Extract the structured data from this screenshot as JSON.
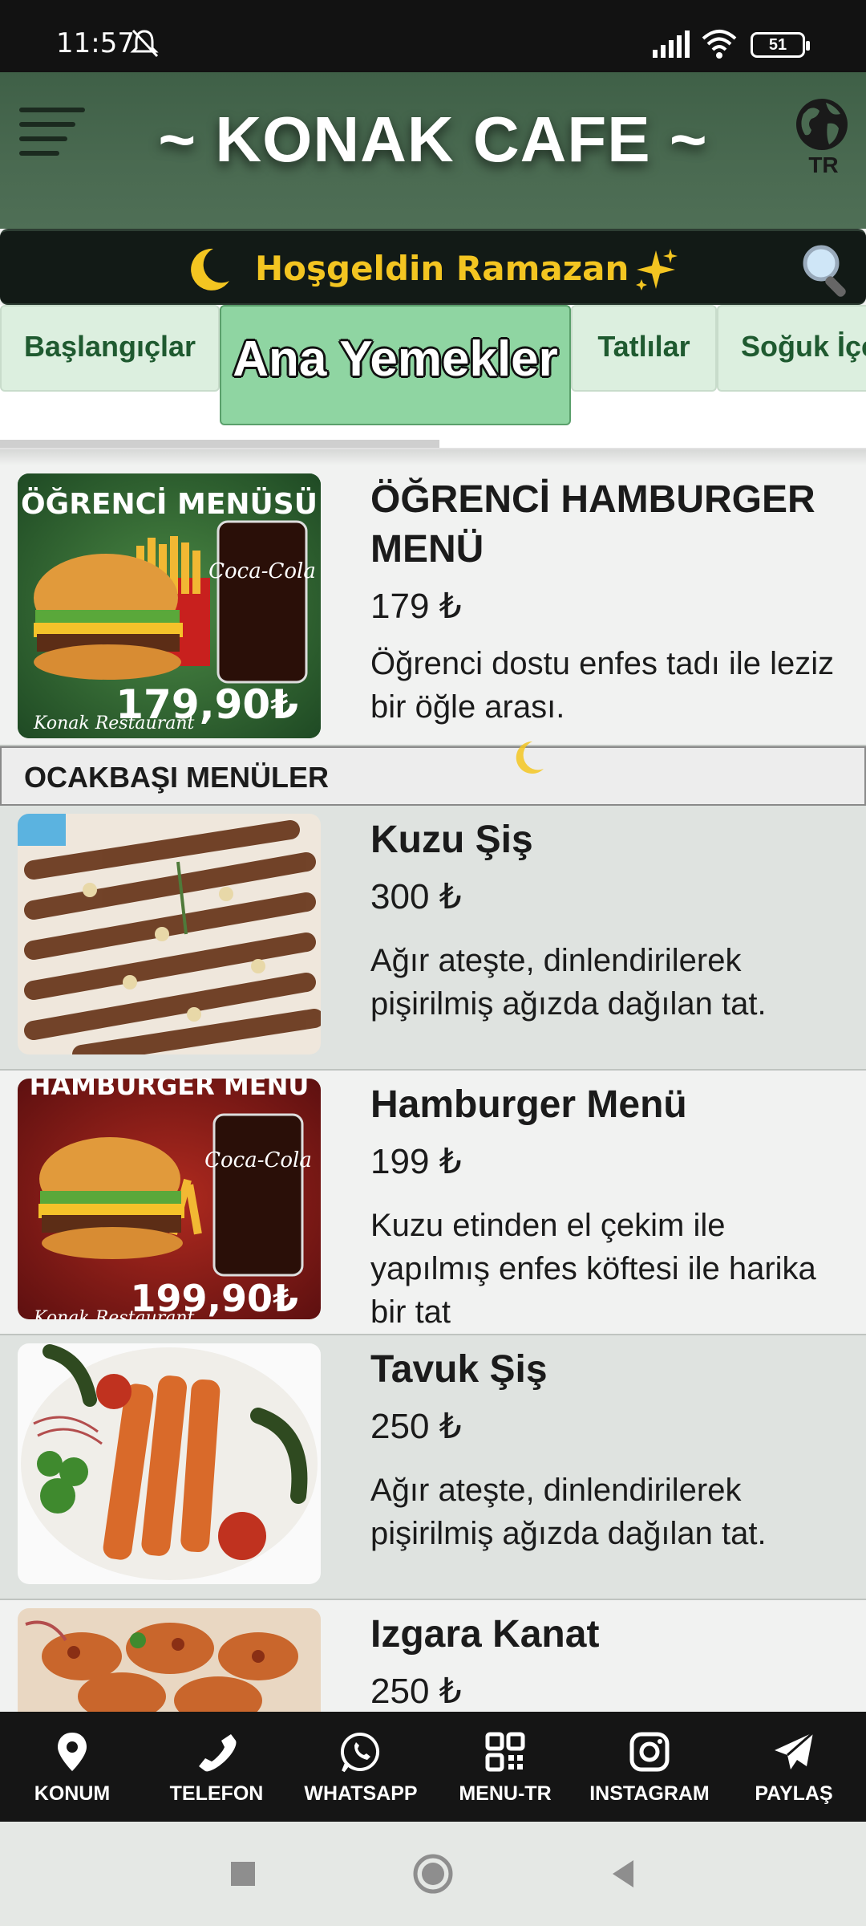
{
  "status_bar": {
    "time": "11:57",
    "battery": "51"
  },
  "header": {
    "title": "~ KONAK CAFE ~",
    "language": "TR"
  },
  "banner": {
    "text": "Hoşgeldin Ramazan"
  },
  "tabs": [
    {
      "label": "Başlangıçlar"
    },
    {
      "label": "Ana Yemekler"
    },
    {
      "label": "Tatlılar"
    },
    {
      "label": "Soğuk İçecekler"
    }
  ],
  "items": [
    {
      "name": "ÖĞRENCİ HAMBURGER MENÜ",
      "price": "179 ₺",
      "description": "Öğrenci dostu enfes tadı ile leziz bir öğle arası.",
      "image_title": "ÖĞRENCİ MENÜSÜ",
      "image_price": "179,90₺",
      "image_footer": "Konak Restaurant"
    },
    {
      "name": "Kuzu Şiş",
      "price": "300 ₺",
      "description": "Ağır ateşte, dinlendirilerek pişirilmiş ağızda dağılan tat."
    },
    {
      "name": "Hamburger Menü",
      "price": "199 ₺",
      "description": "Kuzu etinden el çekim ile yapılmış enfes köftesi ile harika bir tat",
      "image_title": "HAMBURGER MENÜ",
      "image_price": "199,90₺",
      "image_footer": "Konak Restaurant"
    },
    {
      "name": "Tavuk Şiş",
      "price": "250 ₺",
      "description": "Ağır ateşte, dinlendirilerek pişirilmiş ağızda dağılan tat."
    },
    {
      "name": "Izgara Kanat",
      "price": "250 ₺"
    }
  ],
  "section": {
    "title": "OCAKBAŞI MENÜLER"
  },
  "bottom_nav": [
    {
      "label": "KONUM",
      "icon": "location-pin-icon"
    },
    {
      "label": "TELEFON",
      "icon": "phone-icon"
    },
    {
      "label": "WHATSAPP",
      "icon": "whatsapp-icon"
    },
    {
      "label": "MENU-TR",
      "icon": "qr-code-icon"
    },
    {
      "label": "INSTAGRAM",
      "icon": "instagram-icon"
    },
    {
      "label": "PAYLAŞ",
      "icon": "send-icon"
    }
  ],
  "colors": {
    "header_bg": "#4a6a51",
    "banner_text": "#f3c521",
    "active_tab": "#8fd5a2",
    "tab_bg": "#dcefdf",
    "nav_bg": "#151515"
  }
}
